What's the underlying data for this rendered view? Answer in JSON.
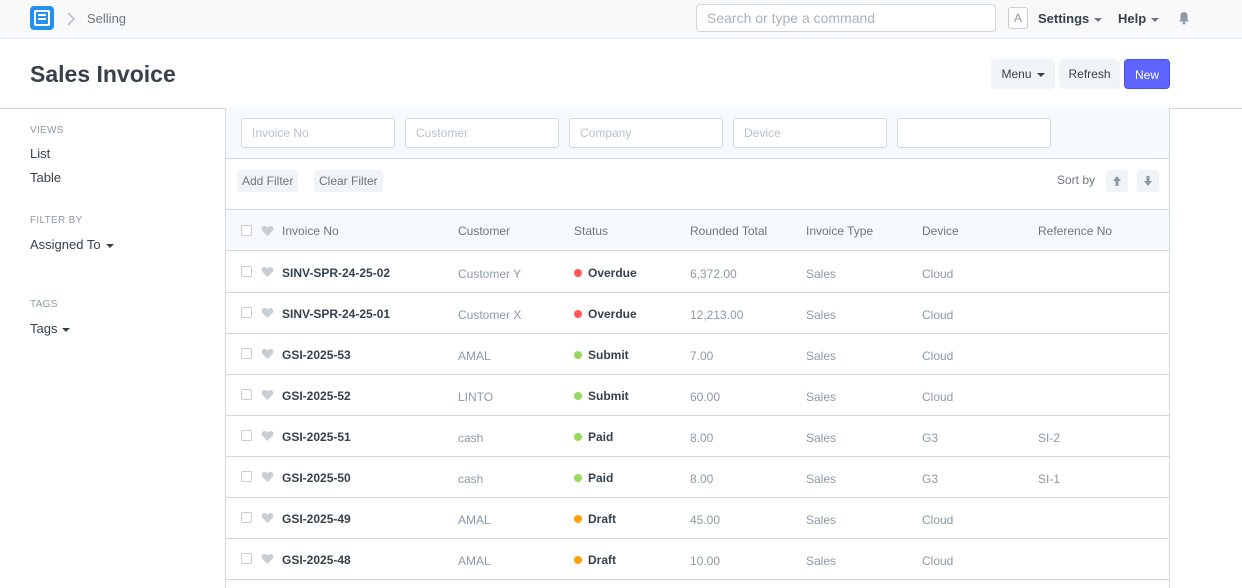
{
  "navbar": {
    "breadcrumb": "Selling",
    "search_placeholder": "Search or type a command",
    "avatar_letter": "A",
    "settings_label": "Settings",
    "help_label": "Help"
  },
  "page": {
    "title": "Sales Invoice",
    "menu_label": "Menu",
    "refresh_label": "Refresh",
    "new_label": "New"
  },
  "sidebar": {
    "views_label": "VIEWS",
    "views": [
      "List",
      "Table"
    ],
    "filter_by_label": "FILTER BY",
    "assigned_to_label": "Assigned To",
    "tags_label": "TAGS",
    "tags_dropdown": "Tags"
  },
  "filters": {
    "placeholders": [
      "Invoice No",
      "Customer",
      "Company",
      "Device",
      ""
    ]
  },
  "toolbar": {
    "add_filter": "Add Filter",
    "clear_filter": "Clear Filter",
    "sort_by": "Sort by"
  },
  "table": {
    "columns": [
      "Invoice No",
      "Customer",
      "Status",
      "Rounded Total",
      "Invoice Type",
      "Device",
      "Reference No"
    ],
    "rows": [
      {
        "name": "SINV-SPR-24-25-02",
        "customer": "Customer Y",
        "status": "Overdue",
        "status_color": "#ff5858",
        "total": "6,372.00",
        "type": "Sales",
        "device": "Cloud",
        "ref": ""
      },
      {
        "name": "SINV-SPR-24-25-01",
        "customer": "Customer X",
        "status": "Overdue",
        "status_color": "#ff5858",
        "total": "12,213.00",
        "type": "Sales",
        "device": "Cloud",
        "ref": ""
      },
      {
        "name": "GSI-2025-53",
        "customer": "AMAL",
        "status": "Submit",
        "status_color": "#98d85b",
        "total": "7.00",
        "type": "Sales",
        "device": "Cloud",
        "ref": ""
      },
      {
        "name": "GSI-2025-52",
        "customer": "LINTO",
        "status": "Submit",
        "status_color": "#98d85b",
        "total": "60.00",
        "type": "Sales",
        "device": "Cloud",
        "ref": ""
      },
      {
        "name": "GSI-2025-51",
        "customer": "cash",
        "status": "Paid",
        "status_color": "#98d85b",
        "total": "8.00",
        "type": "Sales",
        "device": "G3",
        "ref": "SI-2"
      },
      {
        "name": "GSI-2025-50",
        "customer": "cash",
        "status": "Paid",
        "status_color": "#98d85b",
        "total": "8.00",
        "type": "Sales",
        "device": "G3",
        "ref": "SI-1"
      },
      {
        "name": "GSI-2025-49",
        "customer": "AMAL",
        "status": "Draft",
        "status_color": "#ffa00a",
        "total": "45.00",
        "type": "Sales",
        "device": "Cloud",
        "ref": ""
      },
      {
        "name": "GSI-2025-48",
        "customer": "AMAL",
        "status": "Draft",
        "status_color": "#ffa00a",
        "total": "10.00",
        "type": "Sales",
        "device": "Cloud",
        "ref": ""
      }
    ]
  }
}
